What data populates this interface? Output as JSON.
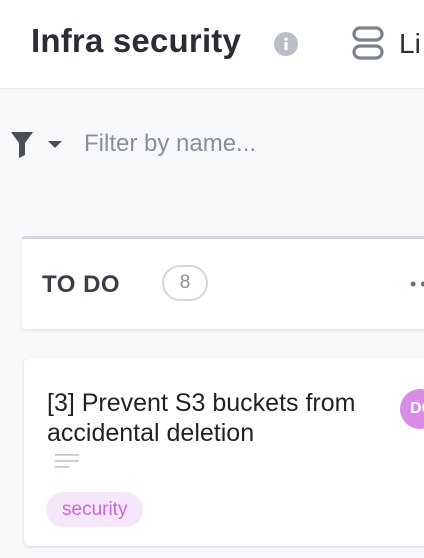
{
  "header": {
    "title": "Infra security",
    "view_label": "Li",
    "icons": {
      "info": "info-icon",
      "view": "list-view-icon"
    }
  },
  "filter": {
    "placeholder": "Filter by name...",
    "icon": "filter-icon"
  },
  "column": {
    "title": "TO DO",
    "count": "8",
    "more_icon": "more-dots-icon"
  },
  "cards": [
    {
      "title": "[3] Prevent S3 buckets from accidental deletion",
      "tag": "security",
      "assignee_initials": "DO"
    }
  ],
  "colors": {
    "tag_bg": "#f6e6fb",
    "tag_text": "#c46ad6",
    "avatar_bg": "#d98de6",
    "column_border": "#d3d6dc"
  }
}
